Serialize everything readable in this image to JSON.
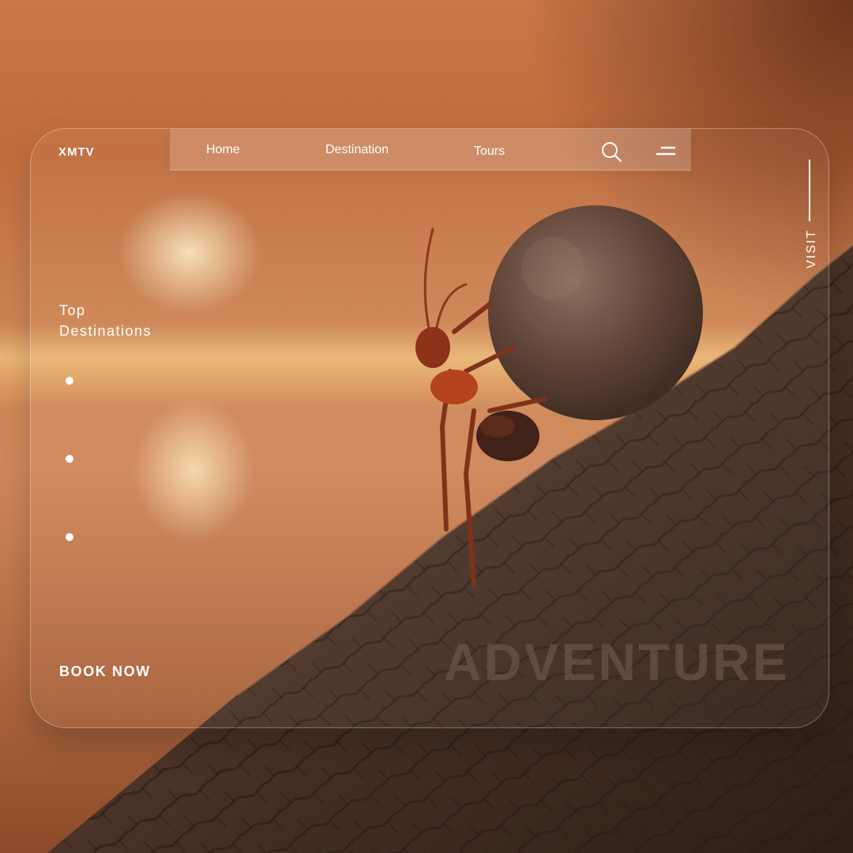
{
  "brand": "XMTV",
  "nav": {
    "home": "Home",
    "destination": "Destination",
    "tours": "Tours"
  },
  "icons": {
    "search": "search-icon",
    "menu": "menu-icon"
  },
  "side": {
    "visit": "VISIT"
  },
  "hero": {
    "heading_line1": "Top",
    "heading_line2": "Destinations",
    "cta": "BOOK NOW",
    "watermark": "ADVENTURE"
  },
  "colors": {
    "accent": "#ffffff",
    "background_warm": "#c87747",
    "bark": "#4a3327"
  }
}
